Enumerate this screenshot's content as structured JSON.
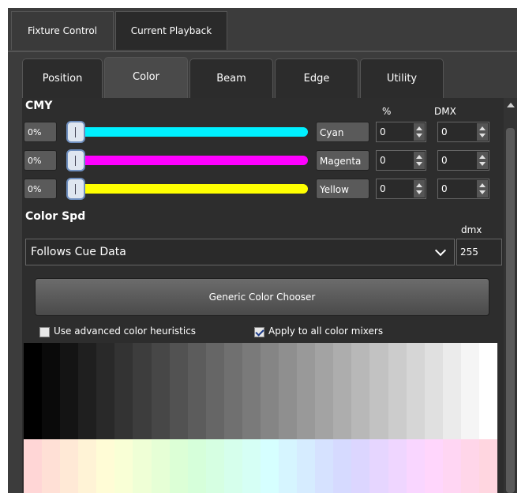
{
  "top_tabs": [
    {
      "label": "Fixture Control",
      "active": false
    },
    {
      "label": "Current Playback",
      "active": true
    }
  ],
  "panel_tabs": [
    {
      "label": "Position",
      "active": false
    },
    {
      "label": "Color",
      "active": true
    },
    {
      "label": "Beam",
      "active": false
    },
    {
      "label": "Edge",
      "active": false
    },
    {
      "label": "Utility",
      "active": false
    }
  ],
  "cmy": {
    "title": "CMY",
    "pct_header": "%",
    "dmx_header": "DMX",
    "channels": [
      {
        "percent": "0%",
        "name": "Cyan",
        "pct_value": "0",
        "dmx_value": "0",
        "color": "#00f0ff",
        "level": 0
      },
      {
        "percent": "0%",
        "name": "Magenta",
        "pct_value": "0",
        "dmx_value": "0",
        "color": "#ff00ff",
        "level": 0
      },
      {
        "percent": "0%",
        "name": "Yellow",
        "pct_value": "0",
        "dmx_value": "0",
        "color": "#ffff00",
        "level": 0
      }
    ]
  },
  "color_spd": {
    "title": "Color Spd",
    "dmx_label": "dmx",
    "selected": "Follows Cue Data",
    "dmx_value": "255"
  },
  "chooser_button": "Generic Color Chooser",
  "checkboxes": {
    "advanced": {
      "label": "Use advanced color heuristics",
      "checked": false
    },
    "apply_all": {
      "label": "Apply to all color mixers",
      "checked": true
    }
  },
  "colors": {
    "background": "#3c3c3c",
    "panel": "#2d2d2d",
    "accent": "#6f8fbf"
  },
  "icons": {
    "dropdown": "chevron-down-icon",
    "scroll_up": "scroll-up-arrow-icon"
  }
}
